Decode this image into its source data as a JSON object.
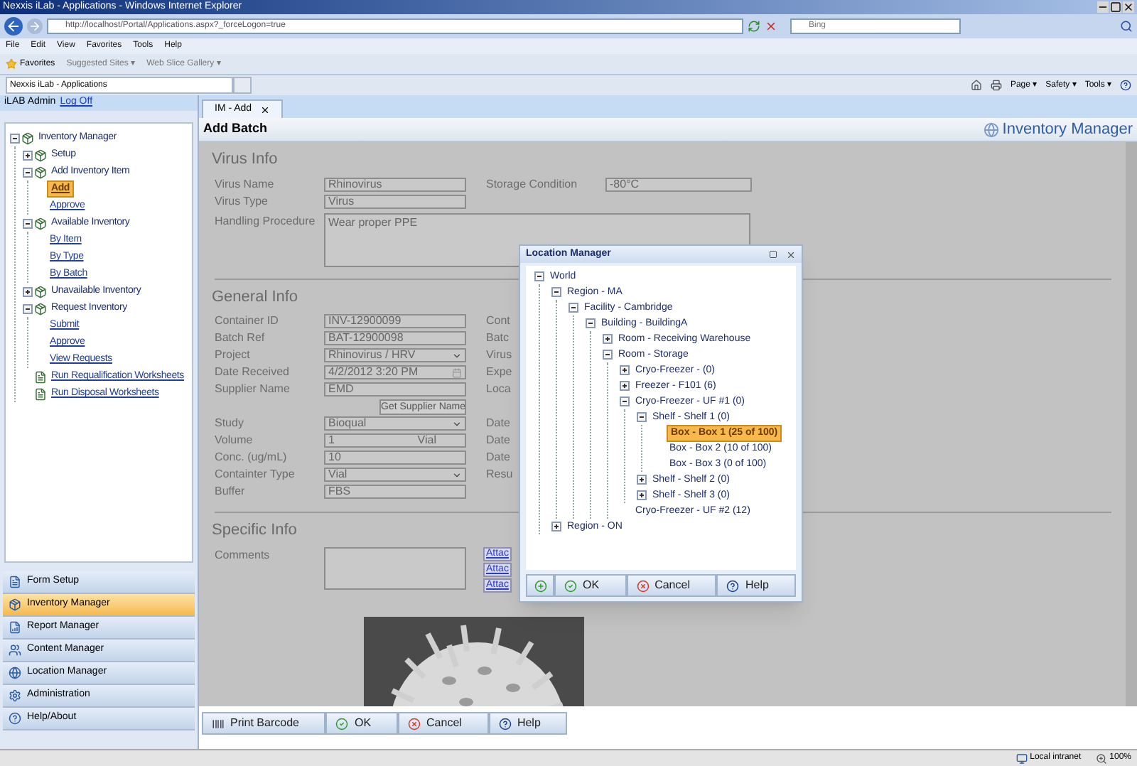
{
  "window": {
    "title": "Nexxis iLab - Applications - Windows Internet Explorer"
  },
  "browser": {
    "address": "http://localhost/Portal/Applications.aspx?_forceLogon=true",
    "search": {
      "placeholder": "Bing"
    },
    "menu": [
      "File",
      "Edit",
      "View",
      "Favorites",
      "Tools",
      "Help"
    ],
    "favorites": {
      "label": "Favorites",
      "links": [
        "Suggested Sites ▾",
        "Web Slice Gallery ▾"
      ]
    },
    "tab": "Nexxis iLab - Applications",
    "commands": [
      "Page ▾",
      "Safety ▾",
      "Tools ▾"
    ]
  },
  "session": {
    "user": "iLAB Admin",
    "logoff": "Log Off"
  },
  "sidebar": {
    "tree": [
      {
        "label": "Inventory Manager",
        "kind": "folder",
        "expanded": true,
        "selected": false,
        "children": [
          {
            "label": "Setup",
            "kind": "folder",
            "expanded": false,
            "selected": false
          },
          {
            "label": "Add Inventory Item",
            "kind": "folder",
            "expanded": true,
            "selected": false,
            "children": [
              {
                "label": "Add",
                "kind": "link",
                "selected": true
              },
              {
                "label": "Approve",
                "kind": "link",
                "selected": false
              }
            ]
          },
          {
            "label": "Available Inventory",
            "kind": "folder",
            "expanded": true,
            "selected": false,
            "children": [
              {
                "label": "By Item",
                "kind": "link",
                "selected": false
              },
              {
                "label": "By Type",
                "kind": "link",
                "selected": false
              },
              {
                "label": "By Batch",
                "kind": "link",
                "selected": false
              }
            ]
          },
          {
            "label": "Unavailable Inventory",
            "kind": "folder",
            "expanded": false,
            "selected": false
          },
          {
            "label": "Request Inventory",
            "kind": "folder",
            "expanded": true,
            "selected": false,
            "children": [
              {
                "label": "Submit",
                "kind": "link",
                "selected": false
              },
              {
                "label": "Approve",
                "kind": "link",
                "selected": false
              },
              {
                "label": "View Requests",
                "kind": "link",
                "selected": false
              }
            ]
          },
          {
            "label": "Run Requalification Worksheets",
            "kind": "action",
            "selected": false
          },
          {
            "label": "Run Disposal Worksheets",
            "kind": "action",
            "selected": false
          }
        ]
      }
    ],
    "nav": [
      {
        "label": "Form Setup",
        "selected": false
      },
      {
        "label": "Inventory Manager",
        "selected": true
      },
      {
        "label": "Report Manager",
        "selected": false
      },
      {
        "label": "Content Manager",
        "selected": false
      },
      {
        "label": "Location Manager",
        "selected": false
      },
      {
        "label": "Administration",
        "selected": false
      },
      {
        "label": "Help/About",
        "selected": false
      }
    ]
  },
  "tabs": [
    {
      "label": "IM - Add",
      "selected": true
    }
  ],
  "page": {
    "title": "Add Batch",
    "logo": "Inventory Manager"
  },
  "sections": [
    {
      "title": "Virus Info",
      "rows": [
        {
          "left": {
            "label": "Virus Name",
            "kind": "text",
            "value": "Rhinovirus"
          },
          "right": {
            "label": "Storage Condition",
            "kind": "text",
            "value": "-80°C"
          }
        },
        {
          "left": {
            "label": "Virus Type",
            "kind": "text",
            "value": "Virus"
          }
        },
        {
          "left": {
            "label": "Handling Procedure",
            "kind": "textarea",
            "value": "Wear proper PPE"
          }
        }
      ]
    },
    {
      "title": "General Info",
      "rows": [
        {
          "left": {
            "label": "Container ID",
            "kind": "text",
            "value": "INV-12900099"
          },
          "right": {
            "label": "Cont",
            "kind": "label"
          }
        },
        {
          "left": {
            "label": "Batch Ref",
            "kind": "text",
            "value": "BAT-12900098"
          },
          "right": {
            "label": "Batc",
            "kind": "label"
          }
        },
        {
          "left": {
            "label": "Project",
            "kind": "select",
            "value": "Rhinovirus / HRV"
          },
          "right": {
            "label": "Virus",
            "kind": "label"
          }
        },
        {
          "left": {
            "label": "Date Received",
            "kind": "date",
            "value": "4/2/2012 3:20 PM"
          },
          "right": {
            "label": "Expe",
            "kind": "label"
          }
        },
        {
          "left": {
            "label": "Supplier Name",
            "kind": "text",
            "value": "EMD"
          },
          "right": {
            "label": "Loca",
            "kind": "label"
          }
        },
        {
          "left": {
            "kind": "button",
            "value": "Get Supplier Name"
          }
        },
        {
          "left": {
            "label": "Study",
            "kind": "select",
            "value": "Bioqual"
          },
          "right": {
            "label": "Date",
            "kind": "label"
          }
        },
        {
          "left": {
            "label": "Volume",
            "kind": "unit",
            "value": "1",
            "unit": "Vial"
          },
          "right": {
            "label": "Date",
            "kind": "label"
          }
        },
        {
          "left": {
            "label": "Conc. (ug/mL)",
            "kind": "text",
            "value": "10"
          },
          "right": {
            "label": "Date",
            "kind": "label"
          }
        },
        {
          "left": {
            "label": "Containter Type",
            "kind": "select",
            "value": "Vial"
          },
          "right": {
            "label": "Resu",
            "kind": "label"
          }
        },
        {
          "left": {
            "label": "Buffer",
            "kind": "text",
            "value": "FBS"
          }
        }
      ]
    },
    {
      "title": "Specific Info",
      "rows": [
        {
          "left": {
            "label": "Comments",
            "kind": "textarea"
          },
          "right": {
            "kind": "links",
            "links": [
              "Attac",
              "Attac",
              "Attac"
            ]
          }
        }
      ],
      "picture": {
        "kind": "picture"
      }
    }
  ],
  "actions": [
    "Print Barcode",
    "OK",
    "Cancel",
    "Help"
  ],
  "dialog": {
    "title": "Location Manager",
    "tree": [
      {
        "label": "World",
        "expanded": true,
        "selected": false,
        "children": [
          {
            "label": "Region - MA",
            "expanded": true,
            "selected": false,
            "children": [
              {
                "label": "Facility - Cambridge",
                "expanded": true,
                "selected": false,
                "children": [
                  {
                    "label": "Building - BuildingA",
                    "expanded": true,
                    "selected": false,
                    "children": [
                      {
                        "label": "Room - Receiving Warehouse",
                        "expanded": false,
                        "selected": false
                      },
                      {
                        "label": "Room - Storage",
                        "expanded": true,
                        "selected": false,
                        "children": [
                          {
                            "label": "Cryo-Freezer - (0)",
                            "expanded": false,
                            "selected": false
                          },
                          {
                            "label": "Freezer - F101 (6)",
                            "expanded": false,
                            "selected": false
                          },
                          {
                            "label": "Cryo-Freezer - UF #1 (0)",
                            "expanded": true,
                            "selected": false,
                            "children": [
                              {
                                "label": "Shelf - Shelf 1 (0)",
                                "expanded": true,
                                "selected": false,
                                "children": [
                                  {
                                    "label": "Box - Box 1 (25 of 100)",
                                    "selected": true
                                  },
                                  {
                                    "label": "Box - Box 2 (10 of 100)",
                                    "selected": false
                                  },
                                  {
                                    "label": "Box - Box 3 (0 of 100)",
                                    "selected": false
                                  }
                                ]
                              },
                              {
                                "label": "Shelf - Shelf 2 (0)",
                                "expanded": false,
                                "selected": false
                              },
                              {
                                "label": "Shelf - Shelf 3 (0)",
                                "expanded": false,
                                "selected": false
                              }
                            ]
                          },
                          {
                            "label": "Cryo-Freezer - UF #2 (12)",
                            "selected": false
                          }
                        ]
                      }
                    ]
                  }
                ]
              }
            ]
          },
          {
            "label": "Region - ON",
            "expanded": false,
            "selected": false
          }
        ]
      }
    ],
    "buttons": [
      "OK",
      "Cancel",
      "Help"
    ]
  },
  "status_bar": {
    "zone": "Local intranet",
    "zoom": "100%"
  }
}
